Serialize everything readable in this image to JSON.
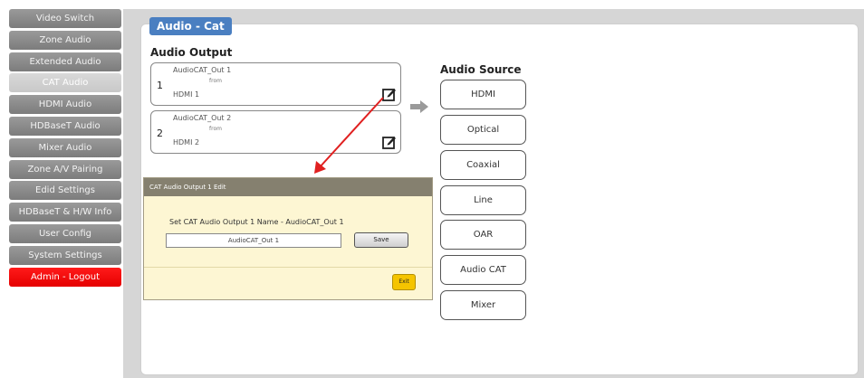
{
  "sidebar": {
    "items": [
      {
        "label": "Video Switch"
      },
      {
        "label": "Zone Audio"
      },
      {
        "label": "Extended Audio"
      },
      {
        "label": "CAT Audio"
      },
      {
        "label": "HDMI Audio"
      },
      {
        "label": "HDBaseT Audio"
      },
      {
        "label": "Mixer Audio"
      },
      {
        "label": "Zone A/V Pairing"
      },
      {
        "label": "Edid Settings"
      },
      {
        "label": "HDBaseT & H/W Info"
      },
      {
        "label": "User Config"
      },
      {
        "label": "System Settings"
      },
      {
        "label": "Admin - Logout"
      }
    ]
  },
  "header": {
    "tab": "Audio - Cat"
  },
  "outputs": {
    "title": "Audio Output",
    "items": [
      {
        "num": "1",
        "name": "AudioCAT_Out 1",
        "from": "from",
        "source": "HDMI 1"
      },
      {
        "num": "2",
        "name": "AudioCAT_Out 2",
        "from": "from",
        "source": "HDMI 2"
      }
    ]
  },
  "source": {
    "title": "Audio Source",
    "buttons": [
      "HDMI",
      "Optical",
      "Coaxial",
      "Line",
      "OAR",
      "Audio CAT",
      "Mixer"
    ]
  },
  "dialog": {
    "title": "CAT Audio Output 1 Edit",
    "label": "Set CAT Audio Output 1 Name - AudioCAT_Out 1",
    "input_value": "AudioCAT_Out 1",
    "save": "Save",
    "exit": "Exit"
  },
  "colors": {
    "tab": "#4a7fc1",
    "logout": "#ff1a1a",
    "annotation_arrow": "#e02020"
  }
}
